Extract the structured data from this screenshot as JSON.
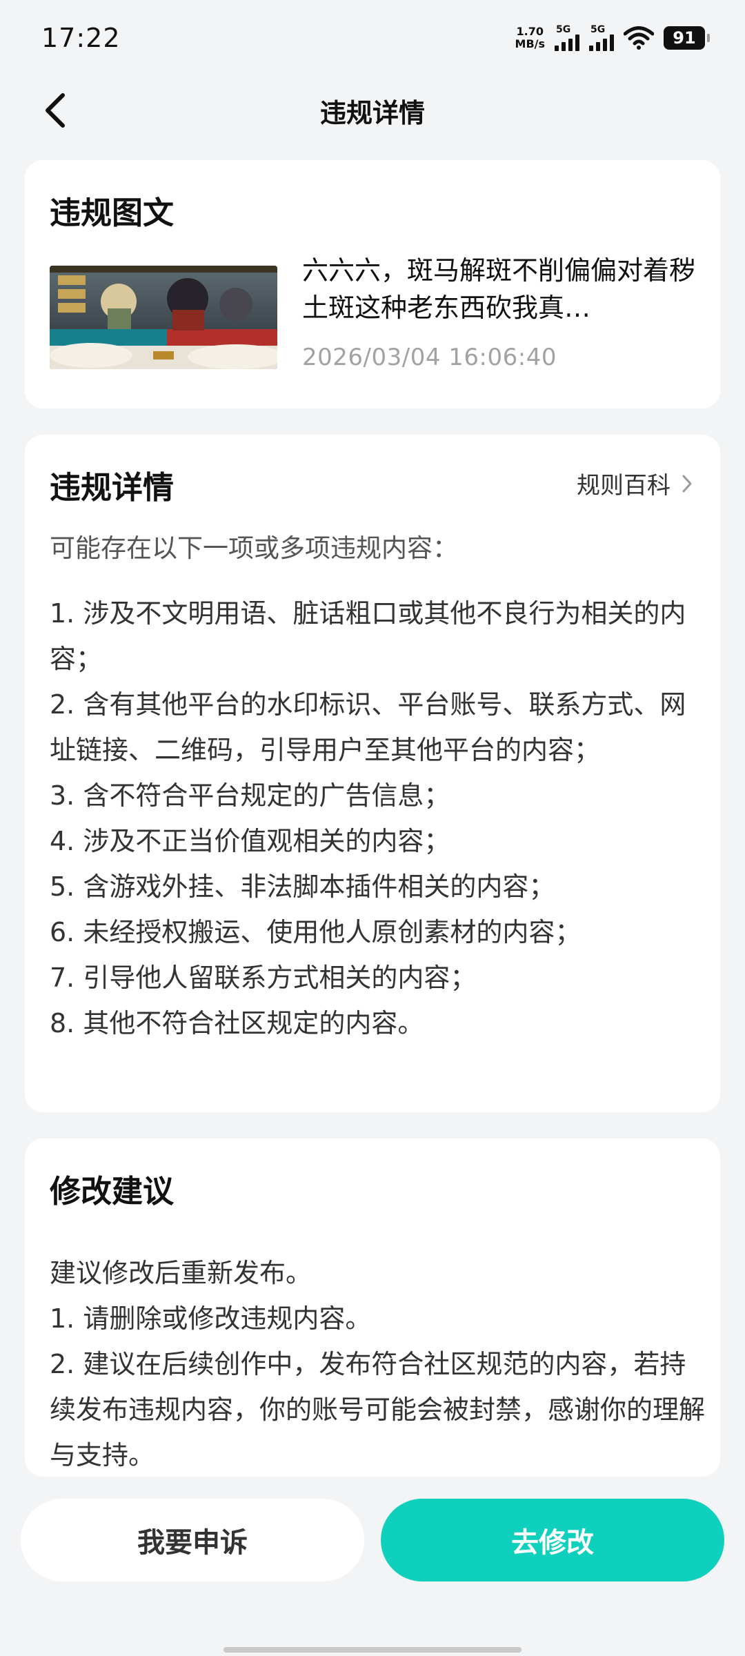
{
  "status_bar": {
    "time": "17:22",
    "net_speed_value": "1.70",
    "net_speed_unit": "MB/s",
    "sim1_label": "5G",
    "sim2_label": "5G",
    "battery": "91"
  },
  "header": {
    "title": "违规详情"
  },
  "violation_post": {
    "section_title": "违规图文",
    "thumbnail_icon": "game-screenshot-thumbnail",
    "text": "六六六，斑马解斑不削偏偏对着秽土斑这种老东西砍我真…",
    "time": "2026/03/04 16:06:40"
  },
  "violation_details": {
    "section_title": "违规详情",
    "rules_link": "规则百科",
    "intro": "可能存在以下一项或多项违规内容：",
    "items": [
      "1. 涉及不文明用语、脏话粗口或其他不良行为相关的内容；",
      "2. 含有其他平台的水印标识、平台账号、联系方式、网址链接、二维码，引导用户至其他平台的内容；",
      "3. 含不符合平台规定的广告信息；",
      "4. 涉及不正当价值观相关的内容；",
      "5. 含游戏外挂、非法脚本插件相关的内容；",
      "6. 未经授权搬运、使用他人原创素材的内容；",
      "7. 引导他人留联系方式相关的内容；",
      "8. 其他不符合社区规定的内容。"
    ]
  },
  "suggestions": {
    "section_title": "修改建议",
    "lines": [
      "建议修改后重新发布。",
      "1. 请删除或修改违规内容。",
      "2. 建议在后续创作中，发布符合社区规范的内容，若持续发布违规内容，你的账号可能会被封禁，感谢你的理解与支持。"
    ]
  },
  "actions": {
    "appeal_label": "我要申诉",
    "modify_label": "去修改"
  },
  "colors": {
    "accent": "#0fcfbd",
    "background": "#f3f4f6",
    "card": "#ffffff",
    "muted_text": "#a2a2a2"
  }
}
